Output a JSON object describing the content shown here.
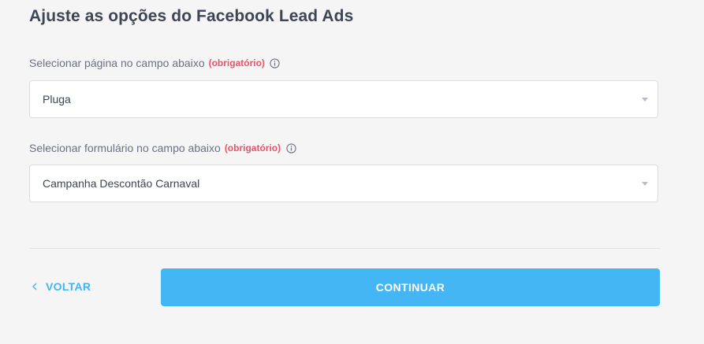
{
  "page": {
    "title": "Ajuste as opções do Facebook Lead Ads"
  },
  "fields": {
    "page_select": {
      "label": "Selecionar página no campo abaixo",
      "required": "(obrigatório)",
      "value": "Pluga"
    },
    "form_select": {
      "label": "Selecionar formulário no campo abaixo",
      "required": "(obrigatório)",
      "value": "Campanha Descontão Carnaval"
    }
  },
  "actions": {
    "back_label": "VOLTAR",
    "continue_label": "CONTINUAR"
  },
  "colors": {
    "accent": "#44b6f4",
    "required": "#e5546b",
    "background": "#f5f5f5"
  },
  "icons": {
    "info": "info-icon",
    "back": "chevron-left-icon",
    "dropdown": "caret-down-icon"
  }
}
